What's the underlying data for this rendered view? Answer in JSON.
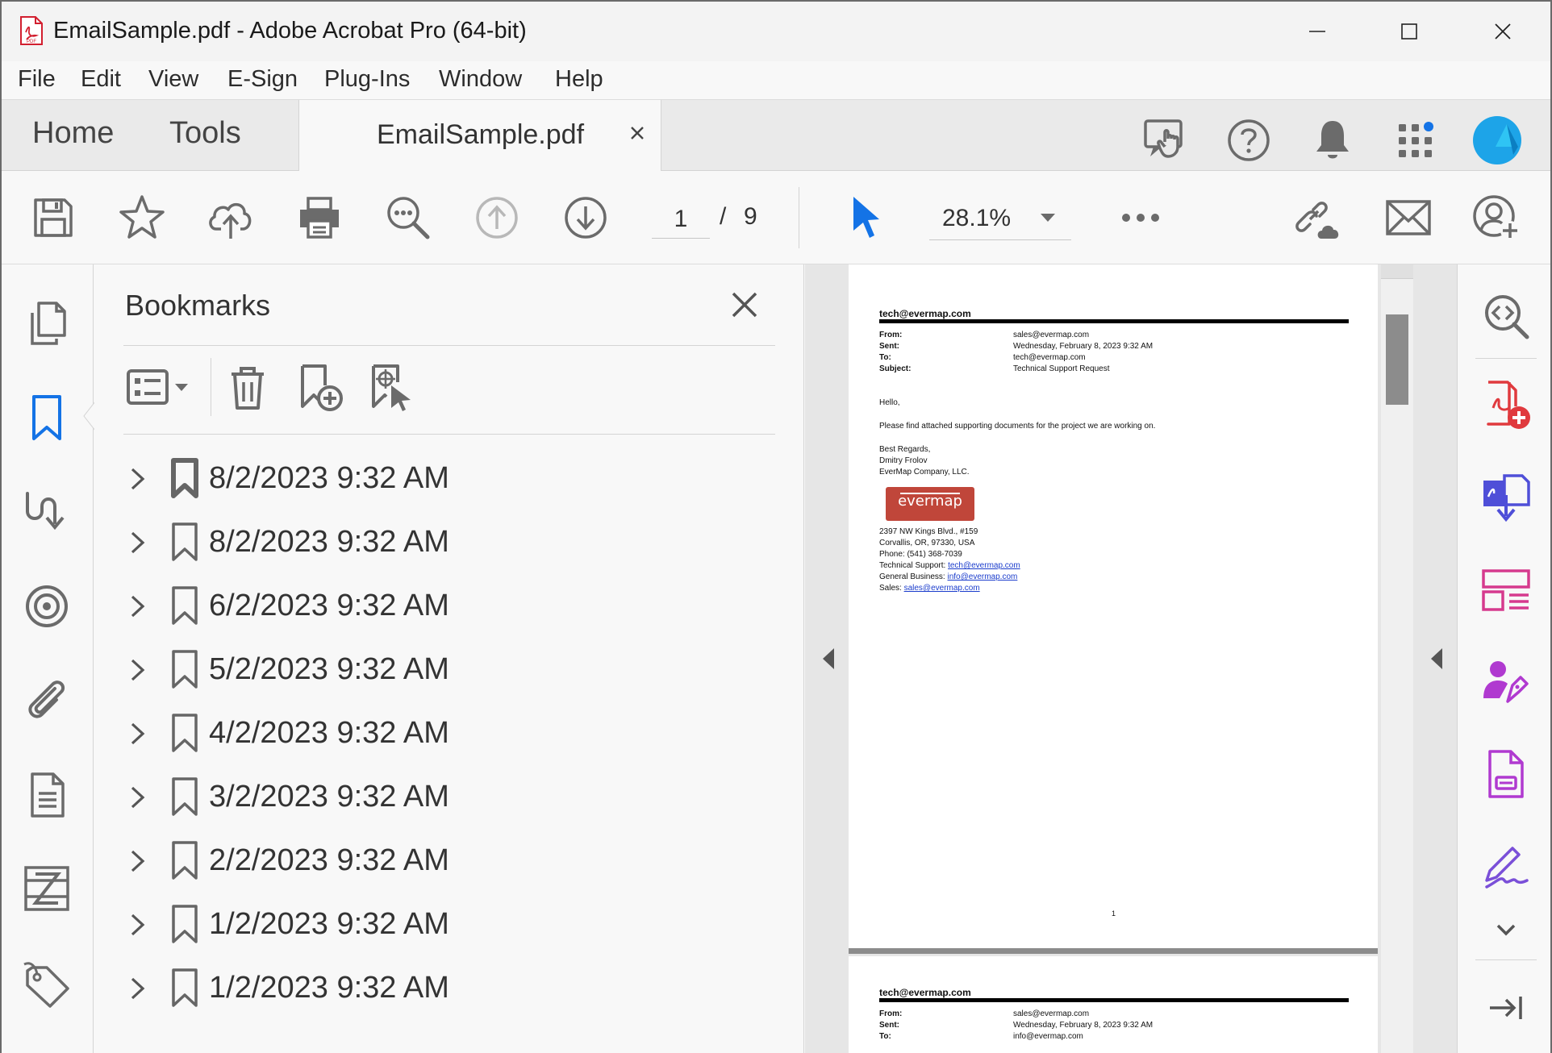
{
  "window": {
    "title": "EmailSample.pdf - Adobe Acrobat Pro (64-bit)",
    "app_icon_label": "PDF"
  },
  "menu": [
    "File",
    "Edit",
    "View",
    "E-Sign",
    "Plug-Ins",
    "Window",
    "Help"
  ],
  "tabs": {
    "home": "Home",
    "tools": "Tools",
    "document": "EmailSample.pdf"
  },
  "toolbar": {
    "current_page": "1",
    "page_separator": "/",
    "total_pages": "9",
    "zoom": "28.1%"
  },
  "bookmarks": {
    "title": "Bookmarks",
    "items": [
      {
        "label": "8/2/2023 9:32 AM",
        "style": "bold"
      },
      {
        "label": "8/2/2023 9:32 AM",
        "style": "normal"
      },
      {
        "label": "6/2/2023 9:32 AM",
        "style": "normal"
      },
      {
        "label": "5/2/2023 9:32 AM",
        "style": "normal"
      },
      {
        "label": "4/2/2023 9:32 AM",
        "style": "normal"
      },
      {
        "label": "3/2/2023 9:32 AM",
        "style": "normal"
      },
      {
        "label": "2/2/2023 9:32 AM",
        "style": "normal"
      },
      {
        "label": "1/2/2023 9:32 AM",
        "style": "normal"
      },
      {
        "label": "1/2/2023 9:32 AM",
        "style": "normal"
      }
    ]
  },
  "pdf": {
    "page1": {
      "header": "tech@evermap.com",
      "fields": [
        {
          "label": "From:",
          "value": "sales@evermap.com"
        },
        {
          "label": "Sent:",
          "value": "Wednesday, February 8, 2023 9:32 AM"
        },
        {
          "label": "To:",
          "value": "tech@evermap.com"
        },
        {
          "label": "Subject:",
          "value": "Technical Support Request"
        }
      ],
      "greeting": "Hello,",
      "body": "Please find attached supporting documents for the project we are working on.",
      "closing": "Best Regards,",
      "signer": "Dmitry Frolov",
      "company": "EverMap Company, LLC.",
      "logo_text": "evermap",
      "address1": "2397 NW Kings Blvd., #159",
      "address2": "Corvallis, OR, 97330, USA",
      "phone": "Phone: (541) 368-7039",
      "support_label": "Technical Support:",
      "support_email": "tech@evermap.com",
      "business_label": "General Business:",
      "business_email": "info@evermap.com",
      "sales_label": "Sales:",
      "sales_email": "sales@evermap.com",
      "page_number": "1"
    },
    "page2": {
      "header": "tech@evermap.com",
      "fields": [
        {
          "label": "From:",
          "value": "sales@evermap.com"
        },
        {
          "label": "Sent:",
          "value": "Wednesday, February 8, 2023 9:32 AM"
        },
        {
          "label": "To:",
          "value": "info@evermap.com"
        }
      ]
    }
  },
  "colors": {
    "accent_blue": "#1473e6",
    "icon_gray": "#6b6b6b",
    "tool_red": "#e03a3e",
    "tool_blue": "#4f4fd8",
    "tool_pink": "#d63a8e",
    "tool_purple": "#b03ad0",
    "logo_red": "#c0463a"
  }
}
